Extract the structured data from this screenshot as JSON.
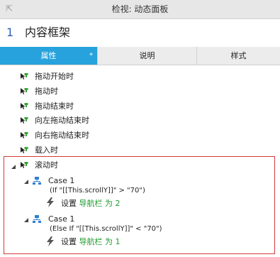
{
  "window": {
    "title": "检视: 动态面板",
    "collapse_icon": "collapse-arrow-icon"
  },
  "header": {
    "number": "1",
    "name": "内容框架"
  },
  "tabs": [
    {
      "label": "属性",
      "active": true,
      "marker": "*"
    },
    {
      "label": "说明",
      "active": false
    },
    {
      "label": "样式",
      "active": false
    }
  ],
  "events": [
    {
      "label": "拖动开始时"
    },
    {
      "label": "拖动时"
    },
    {
      "label": "拖动结束时"
    },
    {
      "label": "向左拖动结束时"
    },
    {
      "label": "向右拖动结束时"
    },
    {
      "label": "载入时"
    },
    {
      "label": "滚动时"
    }
  ],
  "cases": [
    {
      "title": "Case 1",
      "condition": "(If \"[[This.scrollY]]\" > \"70\")",
      "action_prefix": "设置",
      "action_target": "导航栏 为 2"
    },
    {
      "title": "Case 1",
      "condition": "(Else If \"[[This.scrollY]]\" < \"70\")",
      "action_prefix": "设置",
      "action_target": "导航栏 为 1"
    }
  ],
  "colors": {
    "accent": "#27a2dc",
    "number": "#2a5fae",
    "event_icon_green": "#3aa635",
    "action_text_green": "#1f9b2f",
    "highlight_border": "#d23b3b"
  }
}
